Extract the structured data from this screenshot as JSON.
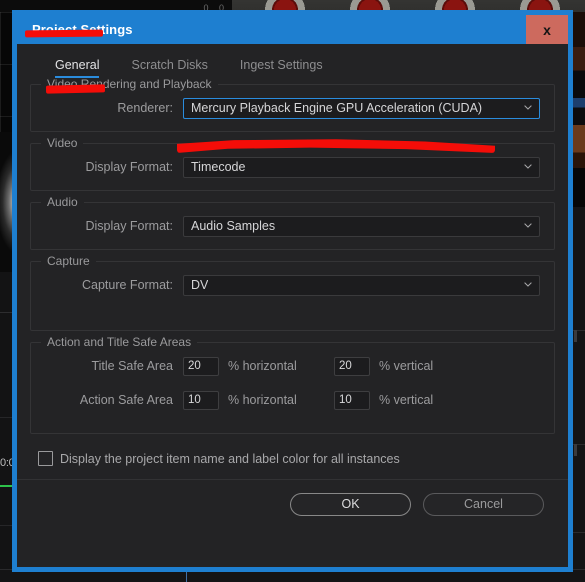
{
  "background": {
    "app_name": "video-editor-behind-dialog",
    "left_panel": {
      "timecode": "0:0",
      "caret_glyph": "⌄"
    },
    "top_ruler_ticks": "0 0"
  },
  "dialog": {
    "title": "Project Settings",
    "close_label": "x",
    "close_icon": "close-icon",
    "tabs": [
      {
        "label": "General",
        "active": true
      },
      {
        "label": "Scratch Disks",
        "active": false
      },
      {
        "label": "Ingest Settings",
        "active": false
      }
    ],
    "groups": {
      "video_rendering": {
        "legend": "Video Rendering and Playback",
        "renderer": {
          "label": "Renderer:",
          "value": "Mercury Playback Engine GPU Acceleration (CUDA)",
          "focused": true
        }
      },
      "video": {
        "legend": "Video",
        "display_format": {
          "label": "Display Format:",
          "value": "Timecode"
        }
      },
      "audio": {
        "legend": "Audio",
        "display_format": {
          "label": "Display Format:",
          "value": "Audio Samples"
        }
      },
      "capture": {
        "legend": "Capture",
        "capture_format": {
          "label": "Capture Format:",
          "value": "DV"
        }
      },
      "safe_areas": {
        "legend": "Action and Title Safe Areas",
        "title_safe": {
          "label": "Title Safe Area",
          "horizontal": "20",
          "horizontal_unit": "% horizontal",
          "vertical": "20",
          "vertical_unit": "% vertical"
        },
        "action_safe": {
          "label": "Action Safe Area",
          "horizontal": "10",
          "horizontal_unit": "% horizontal",
          "vertical": "10",
          "vertical_unit": "% vertical"
        }
      }
    },
    "checkbox": {
      "label": "Display the project item name and label color for all instances",
      "checked": false
    },
    "buttons": {
      "ok": "OK",
      "cancel": "Cancel"
    }
  },
  "annotations": {
    "title_underline": "red-underline-under-project-settings",
    "tab_underline": "red-underline-under-general-tab",
    "renderer_underline": "red-underline-under-renderer-dropdown"
  },
  "colors": {
    "accent_blue": "#1e7fd0",
    "tab_underline_blue": "#2a8cdd",
    "close_button": "#cd6a5e",
    "annotation_red": "#f40d08",
    "dialog_bg": "#232325"
  }
}
